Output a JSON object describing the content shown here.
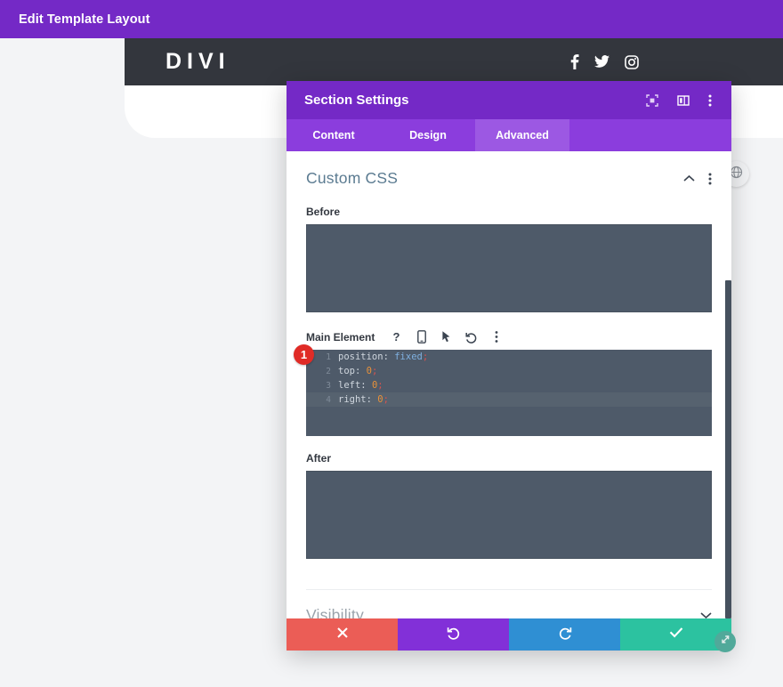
{
  "admin_bar": {
    "title": "Edit Template Layout"
  },
  "site_header": {
    "logo": "DIVI",
    "social": [
      {
        "name": "facebook-icon"
      },
      {
        "name": "twitter-icon"
      },
      {
        "name": "instagram-icon"
      }
    ]
  },
  "modal": {
    "title": "Section Settings",
    "header_icons": [
      {
        "name": "expand-icon"
      },
      {
        "name": "layout-columns-icon"
      },
      {
        "name": "more-vertical-icon"
      }
    ],
    "tabs": [
      {
        "label": "Content",
        "active": false
      },
      {
        "label": "Design",
        "active": false
      },
      {
        "label": "Advanced",
        "active": true
      }
    ],
    "sections": {
      "custom_css": {
        "title": "Custom CSS",
        "toggle_icon": "chevron-up-icon",
        "menu_icon": "more-vertical-icon",
        "before": {
          "label": "Before",
          "value": ""
        },
        "main_element": {
          "label": "Main Element",
          "toolbar_icons": [
            {
              "name": "help-icon"
            },
            {
              "name": "mobile-icon"
            },
            {
              "name": "cursor-icon"
            },
            {
              "name": "undo-icon"
            },
            {
              "name": "more-vertical-icon"
            }
          ],
          "badge": "1",
          "code_lines": [
            {
              "num": "1",
              "prop": "position",
              "value": "fixed",
              "value_type": "keyword",
              "highlight": false
            },
            {
              "num": "2",
              "prop": "top",
              "value": "0",
              "value_type": "number",
              "highlight": false
            },
            {
              "num": "3",
              "prop": "left",
              "value": "0",
              "value_type": "number",
              "highlight": false
            },
            {
              "num": "4",
              "prop": "right",
              "value": "0",
              "value_type": "number",
              "highlight": true
            }
          ]
        },
        "after": {
          "label": "After",
          "value": ""
        }
      },
      "visibility": {
        "title": "Visibility",
        "toggle_icon": "chevron-down-icon"
      }
    },
    "footer_buttons": [
      {
        "name": "cancel-button",
        "icon": "close-icon",
        "color": "#eb5d56"
      },
      {
        "name": "undo-button",
        "icon": "undo-icon",
        "color": "#8230d8"
      },
      {
        "name": "redo-button",
        "icon": "redo-icon",
        "color": "#2f8fd3"
      },
      {
        "name": "save-button",
        "icon": "check-icon",
        "color": "#2cc2a0"
      }
    ],
    "resize_handle_icon": "resize-diagonal-icon"
  },
  "canvas": {
    "globe_button_icon": "globe-icon"
  },
  "colors": {
    "admin_purple": "#7429c6",
    "modal_header_purple": "#7429c6",
    "tabbar_purple": "#8b3ddd",
    "tab_active_purple": "#9c58e3",
    "site_header_dark": "#33363d",
    "textarea_slate": "#4e5a69",
    "badge_red": "#e02b26",
    "section_title_blue": "#5b7b91"
  }
}
